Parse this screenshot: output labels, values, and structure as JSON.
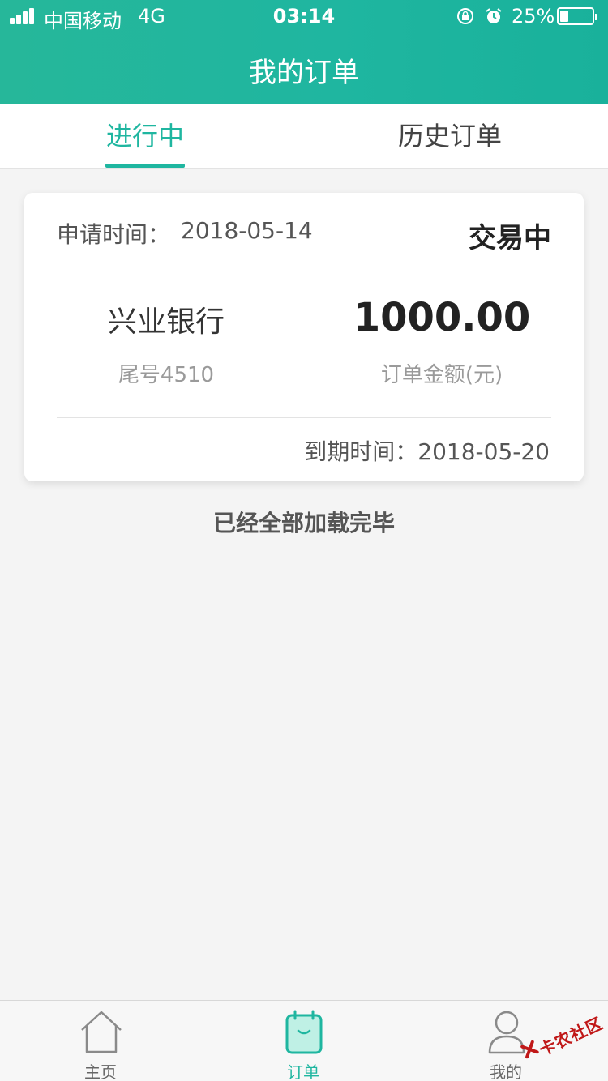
{
  "status_bar": {
    "carrier": "中国移动",
    "network": "4G",
    "time": "03:14",
    "battery": "25%",
    "battery_level": 0.25
  },
  "nav": {
    "title": "我的订单"
  },
  "tabs": [
    {
      "label": "进行中",
      "active": true
    },
    {
      "label": "历史订单",
      "active": false
    }
  ],
  "order": {
    "apply_label": "申请时间：",
    "apply_date": "2018-05-14",
    "status": "交易中",
    "bank_name": "兴业银行",
    "card_tail": "尾号4510",
    "amount": "1000.00",
    "amount_label": "订单金额(元)",
    "due_label": "到期时间：",
    "due_date": "2018-05-20"
  },
  "list_footer": "已经全部加载完毕",
  "tabbar": [
    {
      "label": "主页",
      "icon": "home-icon",
      "active": false
    },
    {
      "label": "订单",
      "icon": "orders-icon",
      "active": true
    },
    {
      "label": "我的",
      "icon": "user-icon",
      "active": false
    }
  ],
  "watermark": "卡农社区",
  "colors": {
    "accent": "#1fb6a0",
    "header_bg": "#21b59c",
    "watermark": "#c01818"
  }
}
